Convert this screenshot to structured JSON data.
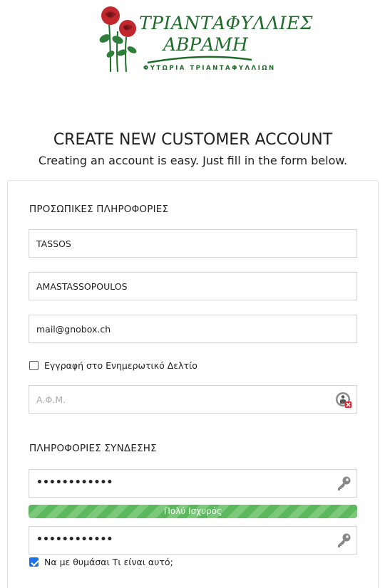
{
  "logo": {
    "brand_line1": "ΤΡΙΑΝΤΑΦΥΛΛΙΕΣ",
    "brand_line2": "ΑΒΡΑΜΗ",
    "tagline": "ΦΥΤΩΡΙΑ ΤΡΙΑΝΤΑΦΥΛΛΙΩΝ",
    "colors": {
      "green": "#1e6b2a",
      "red": "#c0282d"
    }
  },
  "header": {
    "title": "CREATE NEW CUSTOMER ACCOUNT",
    "subtitle": "Creating an account is easy. Just fill in the form below."
  },
  "personal": {
    "section_title": "ΠΡΟΣΩΠΙΚΕΣ ΠΛΗΡΟΦΟΡΙΕΣ",
    "first_name": "TASSOS",
    "last_name": "AMASTASSOPOULOS",
    "email": "mail@gnobox.ch",
    "newsletter_label": "Εγγραφή στο Ενημερωτικό Δελτίο",
    "newsletter_checked": false,
    "vat_placeholder": "Α.Φ.Μ."
  },
  "login": {
    "section_title": "ΠΛΗΡΟΦΟΡΙΕΣ ΣΥΝΔΕΣΗΣ",
    "password_mask": "••••••••••••",
    "confirm_mask": "••••••••••••",
    "strength_label": "Πολύ Ισχυρός",
    "strength_level": 1.0,
    "strength_color": "#5cb85c",
    "remember_label": "Να με θυμάσαι Τι είναι αυτό;",
    "remember_checked": true
  }
}
